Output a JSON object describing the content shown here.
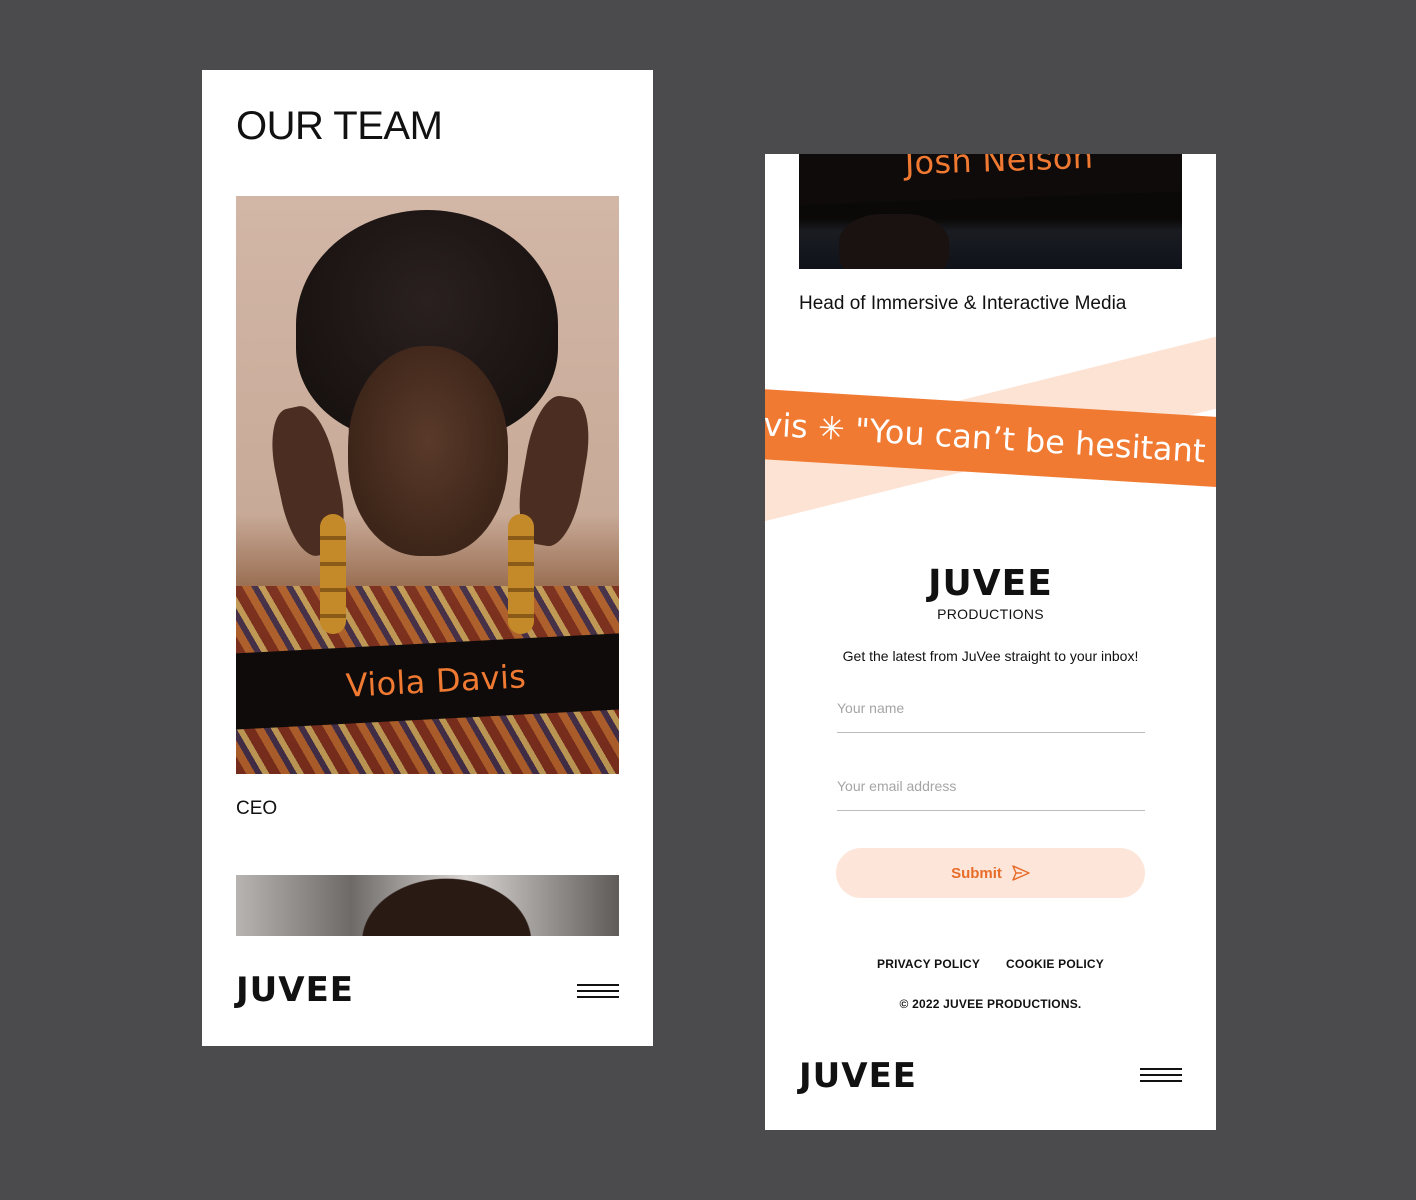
{
  "left_screen": {
    "title": "OUR TEAM",
    "member": {
      "name": "Viola Davis",
      "role": "CEO"
    },
    "logo": "JUVEE"
  },
  "right_screen": {
    "member": {
      "name": "Josh Nelson",
      "role": "Head of Immersive & Interactive Media"
    },
    "quote_ticker": "vis  ✳  \"You can’t be hesitant ab",
    "brand": {
      "name": "JUVEE",
      "subtitle": "PRODUCTIONS"
    },
    "newsletter": {
      "text": "Get the latest from JuVee straight to your inbox!",
      "name_placeholder": "Your name",
      "email_placeholder": "Your email address",
      "submit_label": "Submit"
    },
    "footer": {
      "privacy": "PRIVACY POLICY",
      "cookie": "COOKIE POLICY",
      "copyright": "© 2022 JUVEE PRODUCTIONS."
    },
    "logo": "JUVEE"
  },
  "colors": {
    "accent": "#f07a32",
    "accent_light": "#fde6d9",
    "background": "#4b4b4d"
  },
  "icons": [
    "menu-icon",
    "send-icon",
    "asterisk-icon"
  ]
}
